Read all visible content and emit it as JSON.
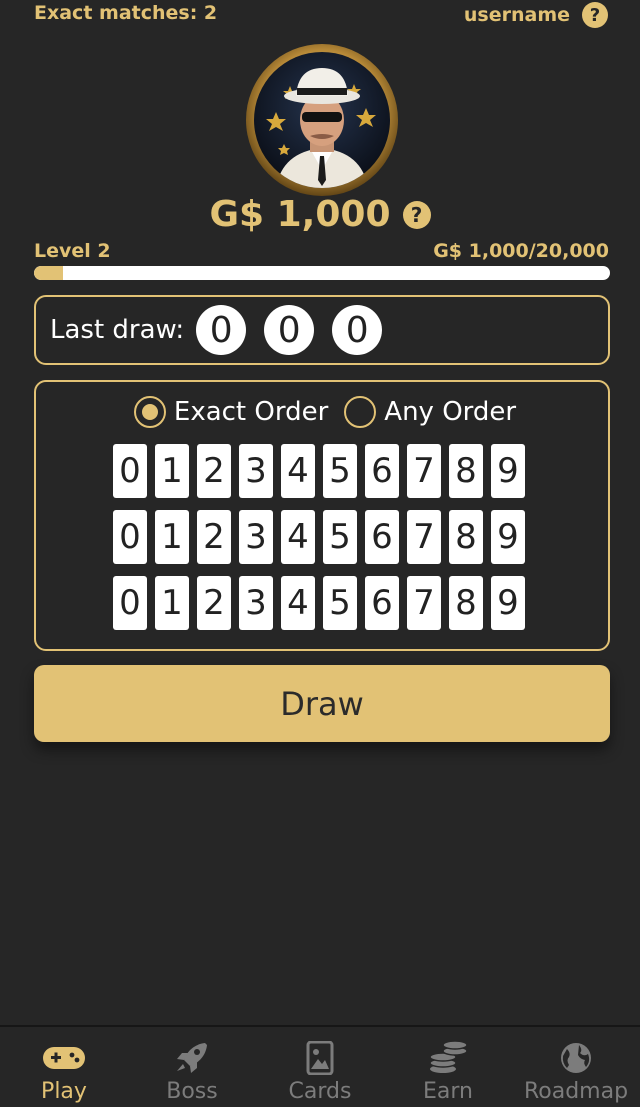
{
  "header": {
    "exact_matches": "Exact matches: 2",
    "username": "username",
    "help_glyph": "?"
  },
  "balance": {
    "amount": "G$ 1,000"
  },
  "level": {
    "label": "Level 2",
    "progress_text": "G$ 1,000/20,000",
    "progress_fraction": 0.05
  },
  "last_draw": {
    "label": "Last draw:",
    "digits": [
      "0",
      "0",
      "0"
    ]
  },
  "order": {
    "exact_label": "Exact Order",
    "any_label": "Any Order",
    "selected": "exact"
  },
  "digit_rows": [
    [
      "0",
      "1",
      "2",
      "3",
      "4",
      "5",
      "6",
      "7",
      "8",
      "9"
    ],
    [
      "0",
      "1",
      "2",
      "3",
      "4",
      "5",
      "6",
      "7",
      "8",
      "9"
    ],
    [
      "0",
      "1",
      "2",
      "3",
      "4",
      "5",
      "6",
      "7",
      "8",
      "9"
    ]
  ],
  "draw_button": "Draw",
  "nav": [
    {
      "label": "Play",
      "icon": "gamepad-icon",
      "active": true
    },
    {
      "label": "Boss",
      "icon": "rocket-icon",
      "active": false
    },
    {
      "label": "Cards",
      "icon": "card-image-icon",
      "active": false
    },
    {
      "label": "Earn",
      "icon": "coins-icon",
      "active": false
    },
    {
      "label": "Roadmap",
      "icon": "globe-icon",
      "active": false
    }
  ],
  "colors": {
    "accent": "#e2c275",
    "background": "#262626",
    "inactive": "#7c7c7c"
  }
}
